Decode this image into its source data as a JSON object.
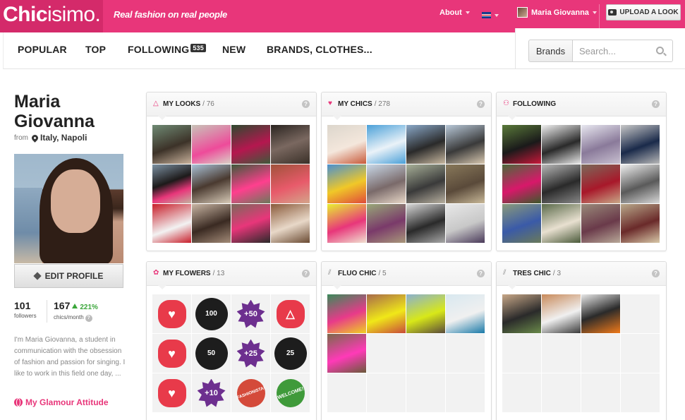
{
  "header": {
    "logo_bold": "Chic",
    "logo_light": "isimo.",
    "tagline": "Real fashion on real people",
    "about_label": "About",
    "user_name": "Maria Giovanna",
    "upload_label": "UPLOAD A LOOK"
  },
  "nav": {
    "popular": "POPULAR",
    "top": "TOP",
    "following": "FOLLOWING",
    "following_count": "535",
    "new": "NEW",
    "brands_clothes": "BRANDS, CLOTHES..."
  },
  "search": {
    "scope_label": "Brands",
    "placeholder": "Search..."
  },
  "profile": {
    "name": "Maria Giovanna",
    "from_label": "from",
    "city": "Italy, Napoli",
    "edit_label": "EDIT PROFILE",
    "followers": "101",
    "followers_label": "followers",
    "chics": "167",
    "chics_trend": "221%",
    "chics_label": "chics/month",
    "bio": "I'm Maria Giovanna, a student in communication with the obsession of fashion and passion for singing. I like to work in this field one day, ...",
    "link_label": "My Glamour Attitude"
  },
  "panels": {
    "looks": {
      "title": "MY LOOKS",
      "count": "/ 76"
    },
    "chics": {
      "title": "MY CHICS",
      "count": "/ 278"
    },
    "following": {
      "title": "FOLLOWING",
      "count": ""
    },
    "flowers": {
      "title": "MY FLOWERS",
      "count": "/ 13"
    },
    "fluo": {
      "title": "FLUO CHIC",
      "count": "/ 5"
    },
    "tres": {
      "title": "TRES CHIC",
      "count": "/ 3"
    }
  },
  "flowers": {
    "f1": "100",
    "f2": "+50",
    "f3": "50",
    "f4": "+25",
    "f5": "25",
    "f6": "+10",
    "f7": "FASHIONISTA!",
    "f8": "WELCOME!"
  },
  "colors": {
    "brand_pink": "#e8367a",
    "brand_pink_dark": "#d42a6a",
    "trend_green": "#3aa63a"
  }
}
